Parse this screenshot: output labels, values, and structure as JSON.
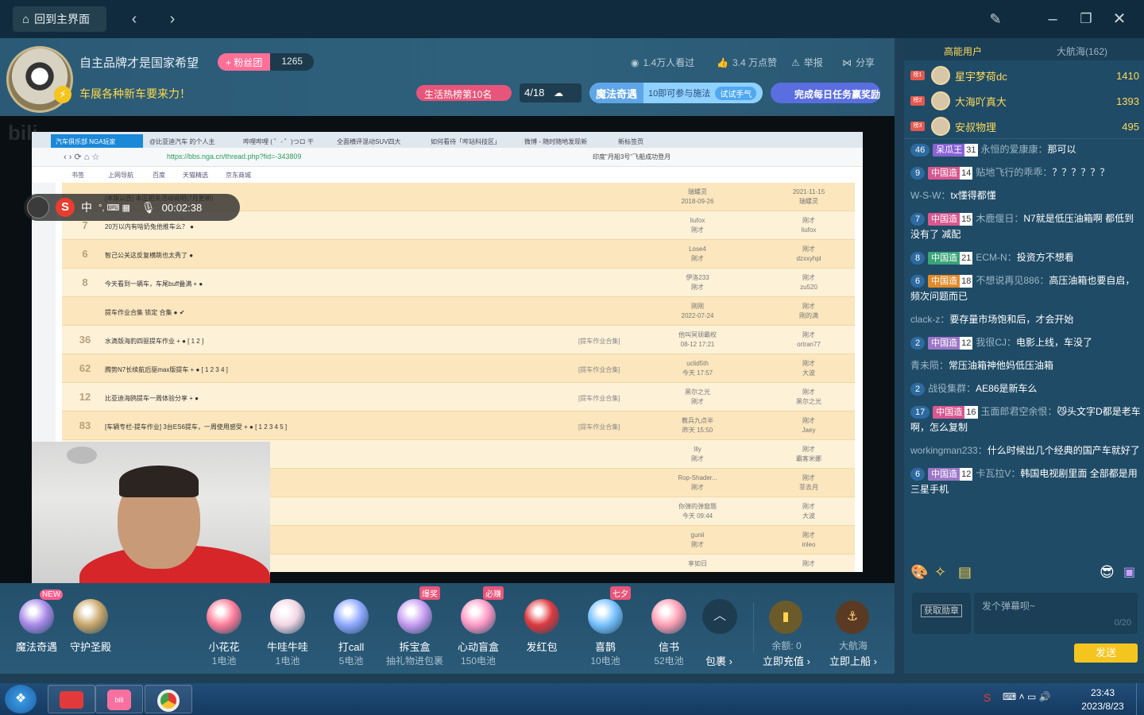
{
  "titlebar": {
    "home_label": "回到主界面",
    "back_icon": "chevron-left-icon",
    "forward_icon": "chevron-right-icon"
  },
  "room": {
    "title": "自主品牌才是国家希望",
    "fan_label": "+ 粉丝团",
    "fan_count": "1265",
    "subtitle": "车展各种新车要来力！",
    "views": "1.4万人看过",
    "likes": "3.4 万点赞",
    "report": "举报",
    "share": "分享",
    "hot_rank": "生活热榜第10名",
    "fraction": "4/18",
    "magic_title": "魔法奇遇",
    "magic_desc": "10即可参与施法",
    "magic_try": "试试手气",
    "daily_task": "完成每日任务赢奖励"
  },
  "screen_share": {
    "tabs": [
      "汽车俱乐部 NGA玩家",
      "@比亚迪汽车 的个人主",
      "哔哩哔哩 ( ゜- ゜)つロ 干",
      "全面横评混动SUV四大",
      "如何看待「哔站科技区」",
      "微博 - 随时随地发现新",
      "新标签页"
    ],
    "url": "https://bbs.nga.cn/thread.php?fid=-343809",
    "address_hint": "印度\"月船3号\"飞船成功登月",
    "bookmarks": [
      "书签",
      "上网导航",
      "百度",
      "天猫精选",
      "京东商城"
    ],
    "rows": [
      {
        "num": "",
        "title": "[本版公告] 本区相关活动说明(7月更新)",
        "cat": "",
        "author": "瑞螺灵",
        "date": "2018-09-26",
        "last": "瑞螺灵",
        "lastdate": "2021-11-15"
      },
      {
        "num": "7",
        "title": "20万以内有啥奶兔他推车么？ ●",
        "cat": "",
        "author": "liufox",
        "date": "刚才",
        "last": "liufox",
        "lastdate": "刚才"
      },
      {
        "num": "6",
        "title": "智己公关这反复横跳也太秀了 ●",
        "cat": "",
        "author": "Lose4",
        "date": "刚才",
        "last": "dzxxyhpl",
        "lastdate": "刚才"
      },
      {
        "num": "8",
        "title": "今天看到一辆车，车尾buff叠满 + ●",
        "cat": "",
        "author": "伊洛233",
        "date": "刚才",
        "last": "zu520",
        "lastdate": "刚才"
      },
      {
        "num": "",
        "title": "提车作业合集 锁定 合集 ● ✔",
        "cat": "",
        "author": "刚刚",
        "date": "2022-07-24",
        "last": "刚的满",
        "lastdate": "刚才"
      },
      {
        "num": "36",
        "title": "水滴版海豹四驱提车作业 + ●  [ 1 2 ]",
        "cat": "[提车作业合集]",
        "author": "他叫冥顽霸权",
        "date": "08-12 17:21",
        "last": "ortran77",
        "lastdate": "刚才"
      },
      {
        "num": "62",
        "title": "腾势N7长续航后驱max版提车 + ●  [ 1 2 3 4 ]",
        "cat": "[提车作业合集]",
        "author": "uclid5th",
        "date": "今天 17:57",
        "last": "大波",
        "lastdate": "刚才"
      },
      {
        "num": "12",
        "title": "比亚迪海鸥提车一周体验分享 + ●",
        "cat": "[提车作业合集]",
        "author": "黑尔之光",
        "date": "刚才",
        "last": "黑尔之光",
        "lastdate": "刚才"
      },
      {
        "num": "83",
        "title": "[车辆专栏-提车作业] 3台ES6提车，一周使用感受 + ●  [ 1 2 3 4 5 ]",
        "cat": "[提车作业合集]",
        "author": "教兵九点半",
        "date": "昨天 15:50",
        "last": "Jaey",
        "lastdate": "刚才"
      },
      {
        "num": "",
        "title": "",
        "cat": "",
        "author": "Illy",
        "date": "刚才",
        "last": "霸客米娜",
        "lastdate": "刚才"
      },
      {
        "num": "",
        "title": "+ ●",
        "cat": "",
        "author": "Rop-Shader...",
        "date": "刚才",
        "last": "菲去月",
        "lastdate": "刚才"
      },
      {
        "num": "",
        "title": "",
        "cat": "",
        "author": "你弹的弹窗题",
        "date": "今天 09:44",
        "last": "大波",
        "lastdate": "刚才"
      },
      {
        "num": "",
        "title": "",
        "cat": "",
        "author": "gunii",
        "date": "刚才",
        "last": "inleo",
        "lastdate": "刚才"
      },
      {
        "num": "",
        "title": "",
        "cat": "",
        "author": "享如日",
        "date": "",
        "last": "",
        "lastdate": "刚才"
      }
    ],
    "rec_time": "00:02:38",
    "ime": "中"
  },
  "gifts": [
    {
      "name": "魔法奇遇",
      "price": "",
      "tag": "NEW",
      "color": "#a98ae8"
    },
    {
      "name": "守护圣殿",
      "price": "",
      "tag": "",
      "color": "#c9a76a"
    },
    {
      "name": "小花花",
      "price": "1电池",
      "tag": "",
      "color": "#ff7d99"
    },
    {
      "name": "牛哇牛哇",
      "price": "1电池",
      "tag": "",
      "color": "#f2d6e4"
    },
    {
      "name": "打call",
      "price": "5电池",
      "tag": "",
      "color": "#8fa9ff"
    },
    {
      "name": "拆宝盒",
      "price": "抽礼物进包裹",
      "tag": "爆奖",
      "color": "#c79cf2"
    },
    {
      "name": "心动盲盒",
      "price": "150电池",
      "tag": "必赚",
      "color": "#ff9ac6"
    },
    {
      "name": "发红包",
      "price": "",
      "tag": "",
      "color": "#e0393f"
    },
    {
      "name": "喜鹊",
      "price": "10电池",
      "tag": "七夕",
      "color": "#77c2ff"
    },
    {
      "name": "信书",
      "price": "52电池",
      "tag": "",
      "color": "#ff9fb4"
    }
  ],
  "giftbar_extra": {
    "package_label": "包裹",
    "balance_label": "余额: 0",
    "recharge_label": "立即充值",
    "voyage_label": "大航海",
    "board_label": "立即上船"
  },
  "rpanel": {
    "tab_high": "高能用户",
    "tab_voyage": "大航海(162)",
    "top_users": [
      {
        "rank": "榜1",
        "name": "星宇梦荷dc",
        "score": "1410"
      },
      {
        "rank": "榜2",
        "name": "大海吖真大",
        "score": "1393"
      },
      {
        "rank": "榜3",
        "name": "安叔物理",
        "score": "495"
      }
    ],
    "messages": [
      {
        "lv": "46",
        "medal": "呆瓜王",
        "medal_lv": "31",
        "medal_color": "#8a62d6",
        "user": "永恒的爱康康：",
        "text": "那可以"
      },
      {
        "lv": "9",
        "medal": "中国造",
        "medal_lv": "14",
        "medal_color": "#d9578e",
        "user": "贴地飞行的乖乖：",
        "text": "？？？？？？"
      },
      {
        "lv": "",
        "medal": "",
        "medal_lv": "",
        "medal_color": "",
        "user": "W-S-W：",
        "text": "tx懂得都懂"
      },
      {
        "lv": "7",
        "medal": "中国造",
        "medal_lv": "15",
        "medal_color": "#d9578e",
        "user": "木鹿偃日：",
        "text": "N7就是低压油箱啊 都低到没有了 减配"
      },
      {
        "lv": "8",
        "medal": "中国造",
        "medal_lv": "21",
        "medal_color": "#3aa37a",
        "user": "ECM-N：",
        "text": "投资方不想看"
      },
      {
        "lv": "6",
        "medal": "中国造",
        "medal_lv": "18",
        "medal_color": "#e08a2a",
        "user": "不想说再见886：",
        "text": "高压油箱也要自启，频次问题而已"
      },
      {
        "lv": "",
        "medal": "",
        "medal_lv": "",
        "medal_color": "",
        "user": "clack-z：",
        "text": "要存量市场饱和后，才会开始"
      },
      {
        "lv": "2",
        "medal": "中国造",
        "medal_lv": "12",
        "medal_color": "#9c77c8",
        "user": "我很CJ：",
        "text": "电影上线，车没了"
      },
      {
        "lv": "",
        "medal": "",
        "medal_lv": "",
        "medal_color": "",
        "user": "青未陨：",
        "text": "常压油箱神他妈低压油箱"
      },
      {
        "lv": "2",
        "medal": "",
        "medal_lv": "",
        "medal_color": "",
        "user": "战役集群：",
        "text": "AE86是新车么"
      },
      {
        "lv": "17",
        "medal": "中国造",
        "medal_lv": "16",
        "medal_color": "#d9578e",
        "user": "玉面郎君空余恨：",
        "text": "😼头文字D都是老车啊，怎么复制"
      },
      {
        "lv": "",
        "medal": "",
        "medal_lv": "",
        "medal_color": "",
        "user": "workingman233：",
        "text": "什么时候出几个经典的国产车就好了"
      },
      {
        "lv": "6",
        "medal": "中国造",
        "medal_lv": "12",
        "medal_color": "#9c77c8",
        "user": "卡瓦拉V：",
        "text": "韩国电视剧里面 全部都是用三星手机"
      }
    ],
    "badge_btn": "获取勋章",
    "input_placeholder": "发个弹幕呗~",
    "char_count": "0/20",
    "send": "发送"
  },
  "taskbar": {
    "time": "23:43",
    "date": "2023/8/23"
  }
}
